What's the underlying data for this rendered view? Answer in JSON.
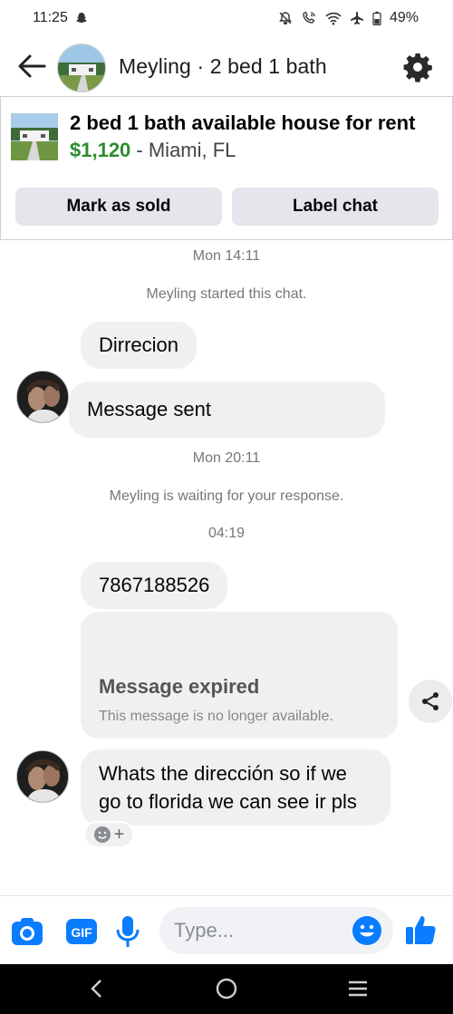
{
  "status_bar": {
    "time": "11:25",
    "battery": "49%",
    "icons": [
      "snapchat-icon",
      "mute-icon",
      "wifi-call-icon",
      "wifi-icon",
      "airplane-icon",
      "battery-icon"
    ]
  },
  "header": {
    "title": "Meyling · 2 bed 1 bath",
    "icons": [
      "back-arrow-icon",
      "gear-icon"
    ]
  },
  "listing": {
    "title": "2 bed 1 bath available house for rent",
    "price": "$1,120",
    "separator": " - ",
    "location": "Miami, FL",
    "buttons": {
      "mark_sold": "Mark as sold",
      "label_chat": "Label chat"
    }
  },
  "chat": {
    "timestamp_1": "Mon 14:11",
    "notice_1": "Meyling started this chat.",
    "msg_1": "Dirrecion",
    "msg_2": "Message sent",
    "timestamp_2": "Mon 20:11",
    "notice_2": "Meyling is waiting for your response.",
    "timestamp_3": "04:19",
    "msg_3": "7867188526",
    "expired_title": "Message expired",
    "expired_sub": "This message is no longer available.",
    "msg_4_line1": "Whats the dirección so if we",
    "msg_4_line2": "go to florida we can see ir pls",
    "reaction_plus": "+"
  },
  "composer": {
    "placeholder": "Type...",
    "gif_label": "GIF",
    "icons": [
      "camera-icon",
      "gif-icon",
      "microphone-icon",
      "emoji-icon",
      "thumbs-up-icon"
    ],
    "accent": "#0a7cff"
  },
  "colors": {
    "price_green": "#2e8b2e",
    "bubble_gray": "#f0f0f0",
    "button_gray": "#e4e6eb"
  }
}
